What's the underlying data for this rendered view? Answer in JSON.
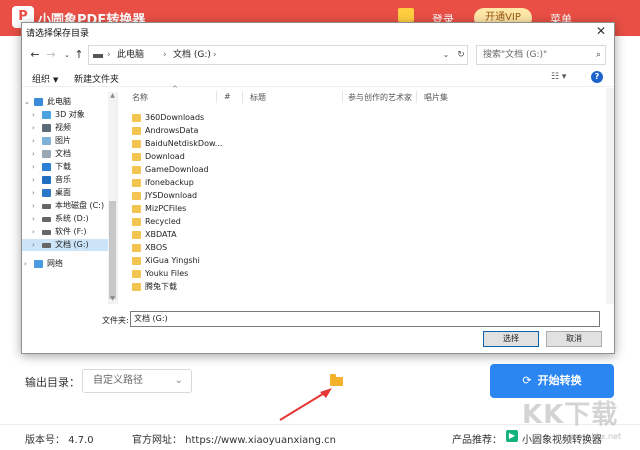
{
  "app": {
    "title": "小圆象PDF转换器",
    "login": "登录",
    "vip": "开通VIP",
    "menu": "菜单",
    "brand_color": "#e94f45"
  },
  "output": {
    "label": "输出目录：",
    "path_select": "自定义路径",
    "start_button": "开始转换"
  },
  "footer": {
    "version": "版本号：  4.7.0",
    "website": "官方网址：  https://www.xiaoyuanxiang.cn",
    "recommend_label": "产品推荐：",
    "recommend_app": "小圆象视频转换器"
  },
  "watermark": {
    "text": "KK下载",
    "sub": "www.kkx.net"
  },
  "dialog": {
    "title": "请选择保存目录",
    "breadcrumb": [
      "此电脑",
      "文档 (G:)"
    ],
    "search_placeholder": "搜索\"文档 (G:)\"",
    "toolbar": {
      "organize": "组织",
      "new_folder": "新建文件夹",
      "help": "?"
    },
    "sidebar": [
      {
        "label": "此电脑",
        "icon": "computer-icon"
      },
      {
        "label": "3D 对象",
        "icon": "3d-objects-icon"
      },
      {
        "label": "视频",
        "icon": "videos-icon"
      },
      {
        "label": "图片",
        "icon": "pictures-icon"
      },
      {
        "label": "文档",
        "icon": "documents-icon"
      },
      {
        "label": "下载",
        "icon": "downloads-icon"
      },
      {
        "label": "音乐",
        "icon": "music-icon"
      },
      {
        "label": "桌面",
        "icon": "desktop-icon"
      },
      {
        "label": "本地磁盘 (C:)",
        "icon": "drive-icon"
      },
      {
        "label": "系统 (D:)",
        "icon": "drive-icon"
      },
      {
        "label": "软件 (F:)",
        "icon": "drive-icon"
      },
      {
        "label": "文档 (G:)",
        "icon": "drive-icon",
        "selected": true
      },
      {
        "label": "网络",
        "icon": "network-icon"
      }
    ],
    "columns": [
      "名称",
      "#",
      "标题",
      "参与创作的艺术家",
      "唱片集"
    ],
    "files": [
      "360Downloads",
      "AndrowsData",
      "BaiduNetdiskDow...",
      "Download",
      "GameDownload",
      "ifonebackup",
      "JYSDownload",
      "MizPCFiles",
      "Recycled",
      "XBDATA",
      "XBOS",
      "XiGua Yingshi",
      "Youku Files",
      "腾兔下载"
    ],
    "filename_label": "文件夹:",
    "filename_value": "文档 (G:)",
    "select_button": "选择",
    "cancel_button": "取消"
  }
}
